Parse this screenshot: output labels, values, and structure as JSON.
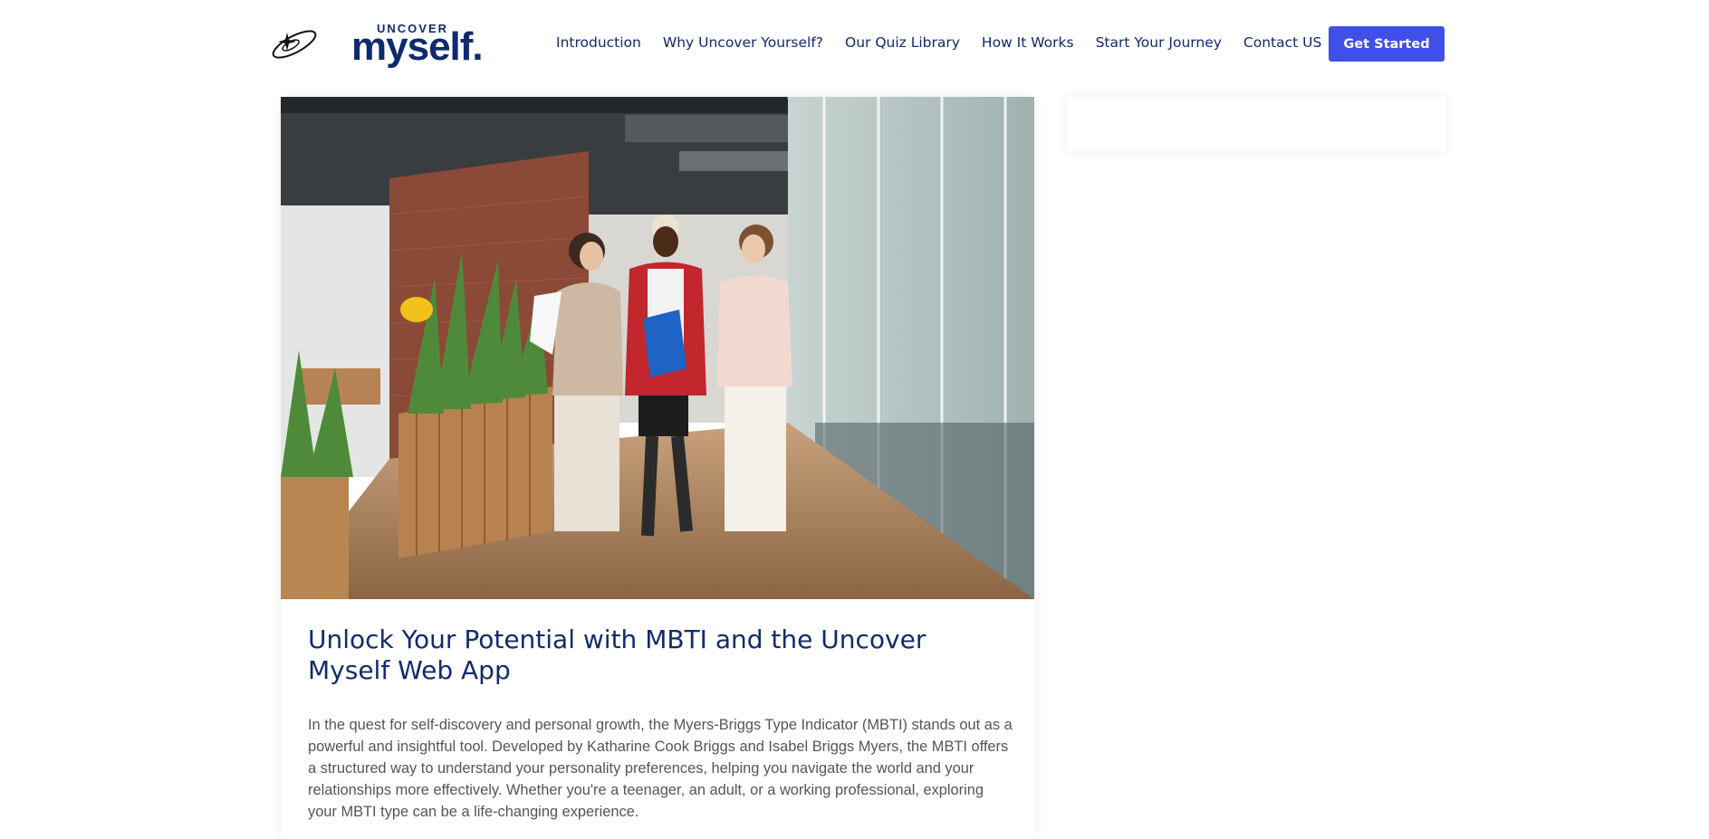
{
  "brand": {
    "logo_top": "UNCOVER",
    "logo_main": "myself."
  },
  "nav": {
    "items": [
      "Introduction",
      "Why Uncover Yourself?",
      "Our Quiz Library",
      "How It Works",
      "Start Your Journey",
      "Contact US"
    ],
    "cta_label": "Get Started"
  },
  "post": {
    "title": "Unlock Your Potential with MBTI and the Uncover Myself Web App",
    "body": "In the quest for self-discovery and personal growth, the Myers-Briggs Type Indicator (MBTI) stands out as a powerful and insightful tool. Developed by Katharine Cook Briggs and Isabel Briggs Myers, the MBTI offers a structured way to understand your personality preferences, helping you navigate the world and your relationships more effectively. Whether you're a teenager, an adult, or a working professional, exploring your MBTI type can be a life-changing experience."
  },
  "colors": {
    "brand_navy": "#0f2a6e",
    "cta_blue": "#3f4fe8",
    "body_text": "#555555"
  },
  "icons": {
    "logo": "orbit-star-icon"
  }
}
